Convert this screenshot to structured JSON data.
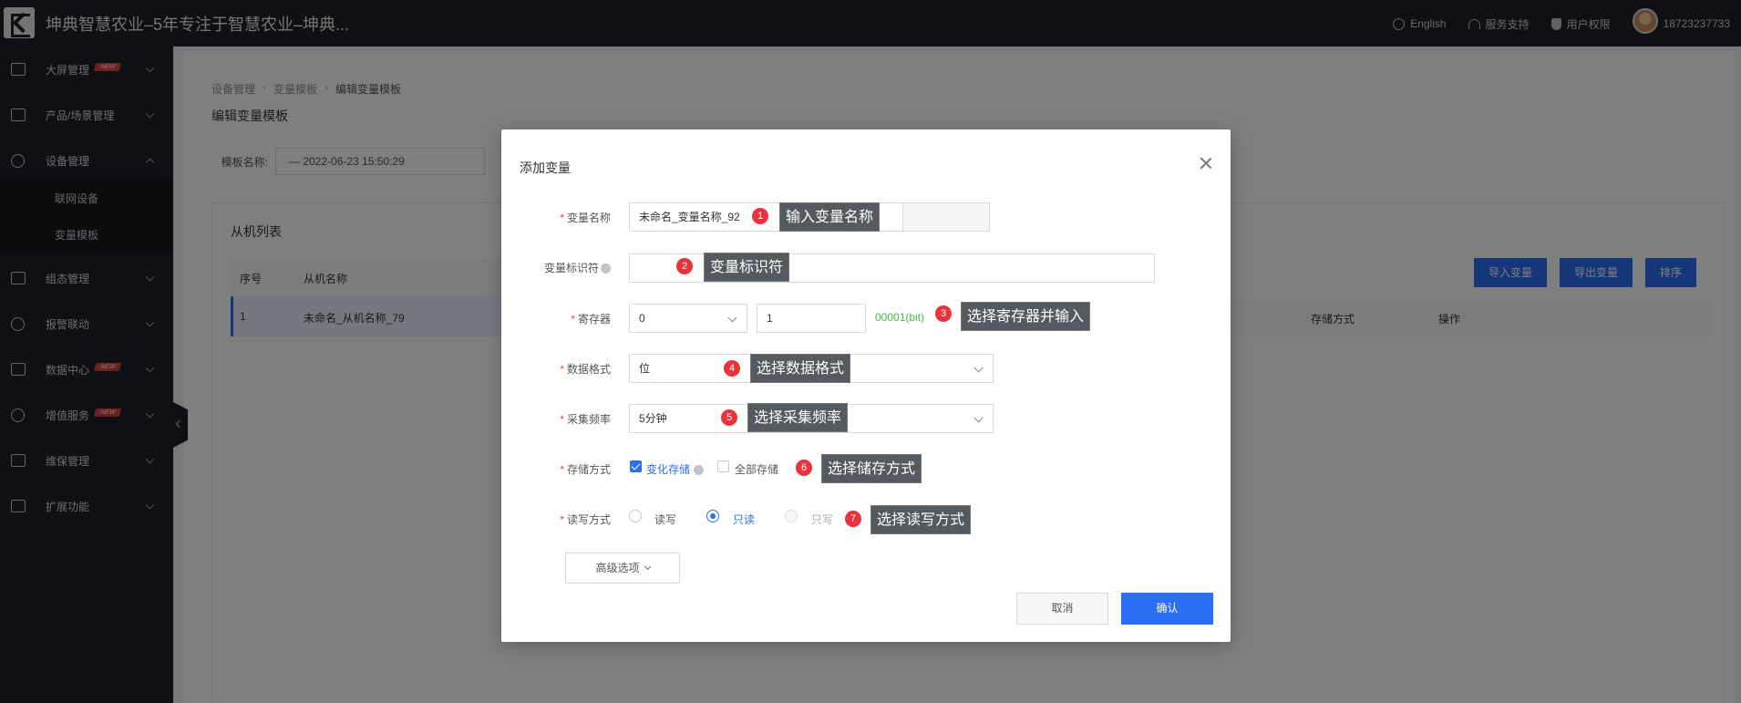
{
  "topbar": {
    "title": "坤典智慧农业–5年专注于智慧农业–坤典...",
    "lang": "English",
    "support": "服务支持",
    "permissions": "用户权限",
    "phone": "18723237733"
  },
  "sidebar": {
    "items": [
      {
        "label": "大屏管理",
        "badge": "NEW"
      },
      {
        "label": "产品/场景管理"
      },
      {
        "label": "设备管理"
      },
      {
        "label": "组态管理"
      },
      {
        "label": "报警联动"
      },
      {
        "label": "数据中心",
        "badge": "NEW"
      },
      {
        "label": "增值服务",
        "badge": "NEW"
      },
      {
        "label": "维保管理"
      },
      {
        "label": "扩展功能"
      }
    ],
    "sub_items": [
      "联网设备",
      "变量模板"
    ]
  },
  "main": {
    "breadcrumb": [
      "设备管理",
      "变量模板",
      "编辑变量模板"
    ],
    "page_title": "编辑变量模板",
    "template_label": "模板名称:",
    "template_value": "— 2022-06-23 15:50:29",
    "slave_list_title": "从机列表",
    "columns": [
      "序号",
      "从机名称"
    ],
    "rows": [
      {
        "index": "1",
        "name": "未命名_从机名称_79"
      }
    ],
    "buttons": [
      "导入变量",
      "导出变量",
      "排序"
    ],
    "var_columns": [
      "存储方式",
      "操作"
    ]
  },
  "modal": {
    "title": "添加变量",
    "fields": {
      "name_label": "变量名称",
      "name_value": "未命名_变量名称_92",
      "identifier_label": "变量标识符",
      "register_label": "寄存器",
      "register_select": "0",
      "register_input": "1",
      "register_hint": "00001(bit)",
      "format_label": "数据格式",
      "format_value": "位",
      "freq_label": "采集频率",
      "freq_value": "5分钟",
      "storage_label": "存储方式",
      "storage_change": "变化存储",
      "storage_all": "全部存储",
      "rw_label": "读写方式",
      "rw_readwrite": "读写",
      "rw_readonly": "只读",
      "rw_writeonly": "只写"
    },
    "advanced": "高级选项",
    "cancel": "取消",
    "confirm": "确认"
  },
  "callouts": [
    {
      "n": "1",
      "text": "输入变量名称"
    },
    {
      "n": "2",
      "text": "变量标识符"
    },
    {
      "n": "3",
      "text": "选择寄存器并输入"
    },
    {
      "n": "4",
      "text": "选择数据格式"
    },
    {
      "n": "5",
      "text": "选择采集频率"
    },
    {
      "n": "6",
      "text": "选择储存方式"
    },
    {
      "n": "7",
      "text": "选择读写方式"
    }
  ]
}
